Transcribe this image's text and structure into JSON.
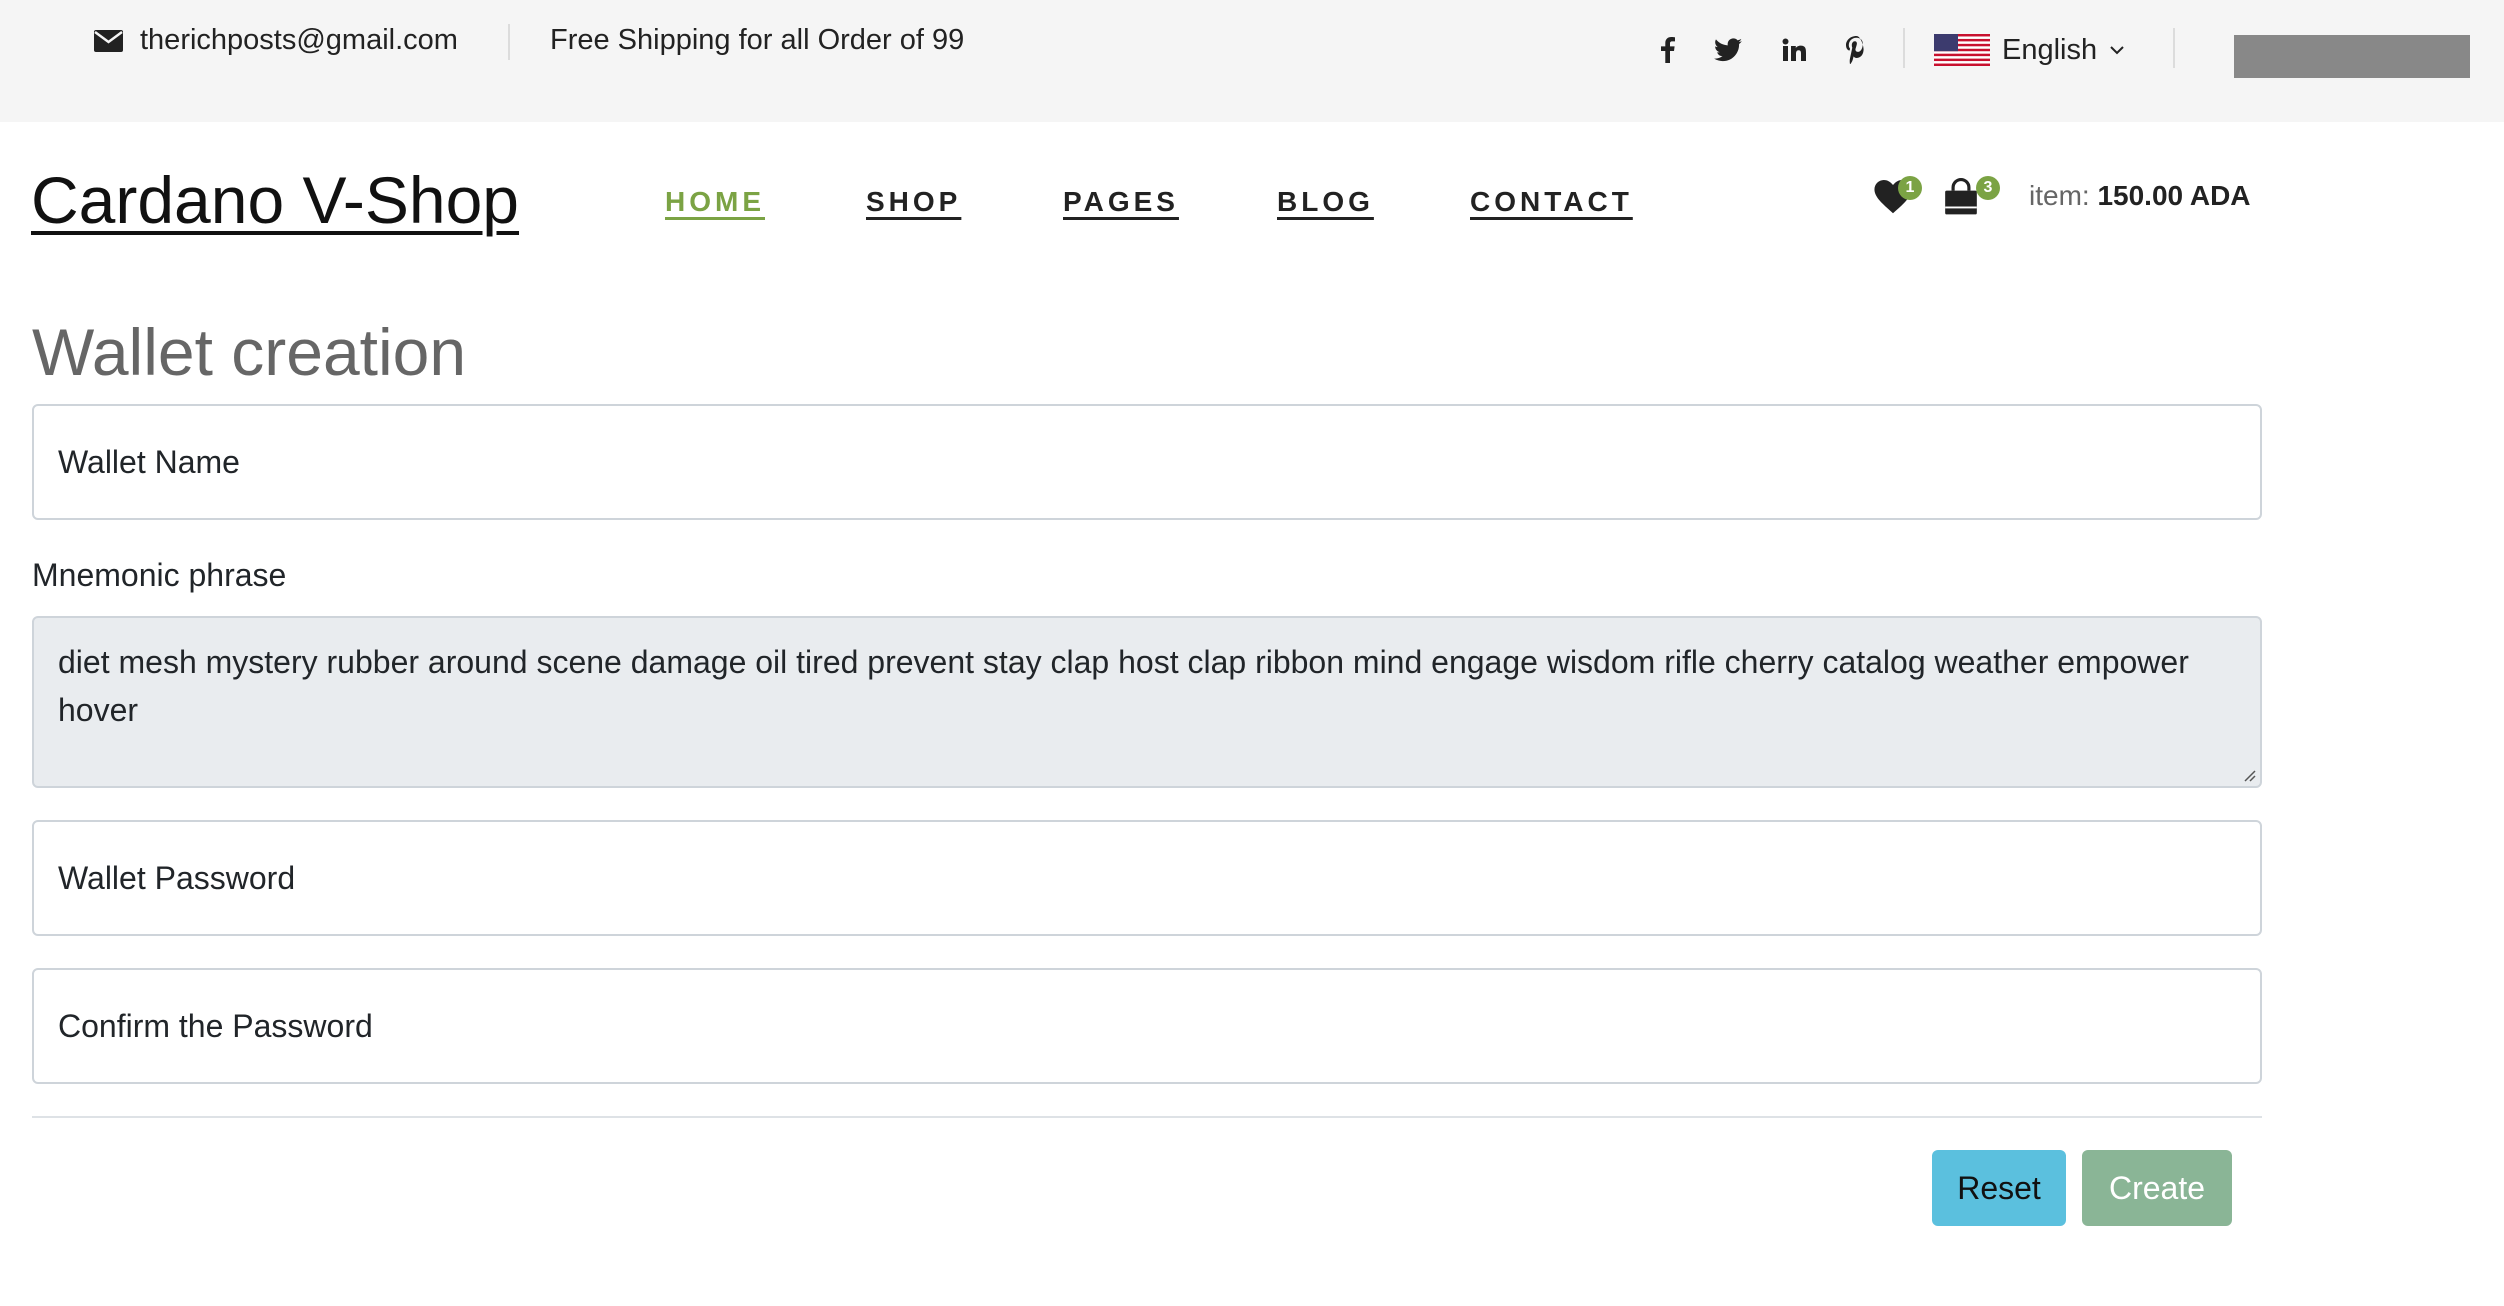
{
  "topbar": {
    "email": "therichposts@gmail.com",
    "shipping": "Free Shipping for all Order of 99",
    "social": [
      "facebook-icon",
      "twitter-icon",
      "linkedin-icon",
      "pinterest-icon"
    ],
    "language": "English"
  },
  "header": {
    "brand": "Cardano V-Shop",
    "nav": [
      {
        "label": "HOME",
        "active": true
      },
      {
        "label": "SHOP",
        "active": false
      },
      {
        "label": "PAGES",
        "active": false
      },
      {
        "label": "BLOG",
        "active": false
      },
      {
        "label": "CONTACT",
        "active": false
      }
    ],
    "wishlist_count": "1",
    "cart_count": "3",
    "cart_label": "item:",
    "cart_total": "150.00 ADA"
  },
  "form": {
    "title": "Wallet creation",
    "wallet_name_placeholder": "Wallet Name",
    "mnemonic_label": "Mnemonic phrase",
    "mnemonic_value": "diet mesh mystery rubber around scene damage oil tired prevent stay clap host clap ribbon mind engage wisdom rifle cherry catalog weather empower hover",
    "password_placeholder": "Wallet Password",
    "confirm_placeholder": "Confirm the Password",
    "reset_label": "Reset",
    "create_label": "Create"
  },
  "colors": {
    "accent": "#7ba344",
    "topbar_bg": "#f5f5f5",
    "reset_btn": "#5bc0de",
    "create_btn": "#8ab596",
    "textarea_bg": "#e9ecef"
  }
}
